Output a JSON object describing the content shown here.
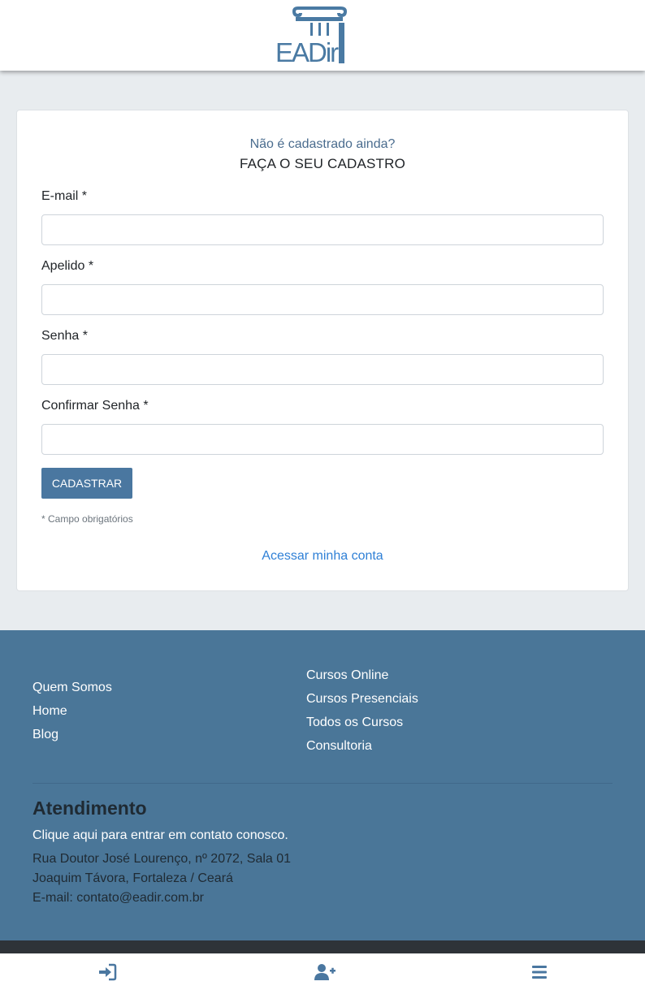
{
  "header": {
    "logo": {
      "text": "EADir",
      "icon": "column-capital-logo",
      "color": "#4a7aa3"
    }
  },
  "form": {
    "question": "Não é cadastrado ainda?",
    "subtitle": "FAÇA O SEU CADASTRO",
    "fields": [
      {
        "label": "E-mail *",
        "value": "",
        "placeholder": ""
      },
      {
        "label": "Apelido *",
        "value": "",
        "placeholder": ""
      },
      {
        "label": "Senha *",
        "value": "",
        "placeholder": ""
      },
      {
        "label": "Confirmar Senha *",
        "value": "",
        "placeholder": ""
      }
    ],
    "submit_label": "CADASTRAR",
    "required_note": "* Campo obrigatórios",
    "login_link": "Acessar minha conta"
  },
  "footer": {
    "left_links": [
      "Quem Somos",
      "Home",
      "Blog"
    ],
    "right_links": [
      "Cursos Online",
      "Cursos Presenciais",
      "Todos os Cursos",
      "Consultoria"
    ],
    "heading": "Atendimento",
    "contact_link": "Clique aqui para entrar em contato conosco.",
    "address_lines": [
      "Rua Doutor José Lourenço, nº 2072, Sala 01",
      "Joaquim Távora, Fortaleza / Ceará",
      "E-mail: contato@eadir.com.br"
    ]
  },
  "bottom_nav": {
    "icons": [
      "sign-in-icon",
      "user-plus-icon",
      "menu-icon"
    ]
  },
  "colors": {
    "brand": "#4a77a0",
    "footer_bg": "#4a7698",
    "link": "#2f80d6",
    "accent_text": "#4a6c8e"
  }
}
